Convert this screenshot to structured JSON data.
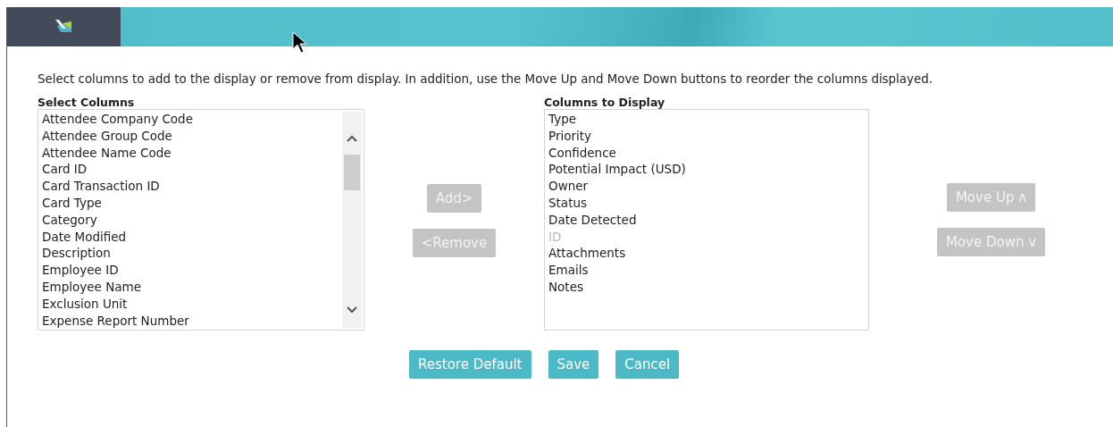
{
  "instructions": "Select columns to add to the display or remove from display. In addition, use the Move Up and Move Down buttons to reorder the columns displayed.",
  "available": {
    "label": "Select Columns",
    "items": [
      "Attendee Company Code",
      "Attendee Group Code",
      "Attendee Name Code",
      "Card ID",
      "Card Transaction ID",
      "Card Type",
      "Category",
      "Date Modified",
      "Description",
      "Employee ID",
      "Employee Name",
      "Exclusion Unit",
      "Expense Report Number"
    ]
  },
  "transfer_buttons": [
    {
      "label": "Add>",
      "disabled": true
    },
    {
      "label": "<Remove",
      "disabled": true
    }
  ],
  "displayed": {
    "label": "Columns to Display",
    "items": [
      {
        "label": "Type",
        "disabled": false
      },
      {
        "label": "Priority",
        "disabled": false
      },
      {
        "label": "Confidence",
        "disabled": false
      },
      {
        "label": "Potential Impact (USD)",
        "disabled": false
      },
      {
        "label": "Owner",
        "disabled": false
      },
      {
        "label": "Status",
        "disabled": false
      },
      {
        "label": "Date Detected",
        "disabled": false
      },
      {
        "label": "ID",
        "disabled": true
      },
      {
        "label": "Attachments",
        "disabled": false
      },
      {
        "label": "Emails",
        "disabled": false
      },
      {
        "label": "Notes",
        "disabled": false
      }
    ]
  },
  "order_buttons": [
    {
      "label": "Move Up ʌ",
      "disabled": true
    },
    {
      "label": "Move Down v",
      "disabled": true
    }
  ],
  "footer_buttons": [
    {
      "label": "Restore Default",
      "disabled": false
    },
    {
      "label": "Save",
      "disabled": false
    },
    {
      "label": "Cancel",
      "disabled": false
    }
  ]
}
